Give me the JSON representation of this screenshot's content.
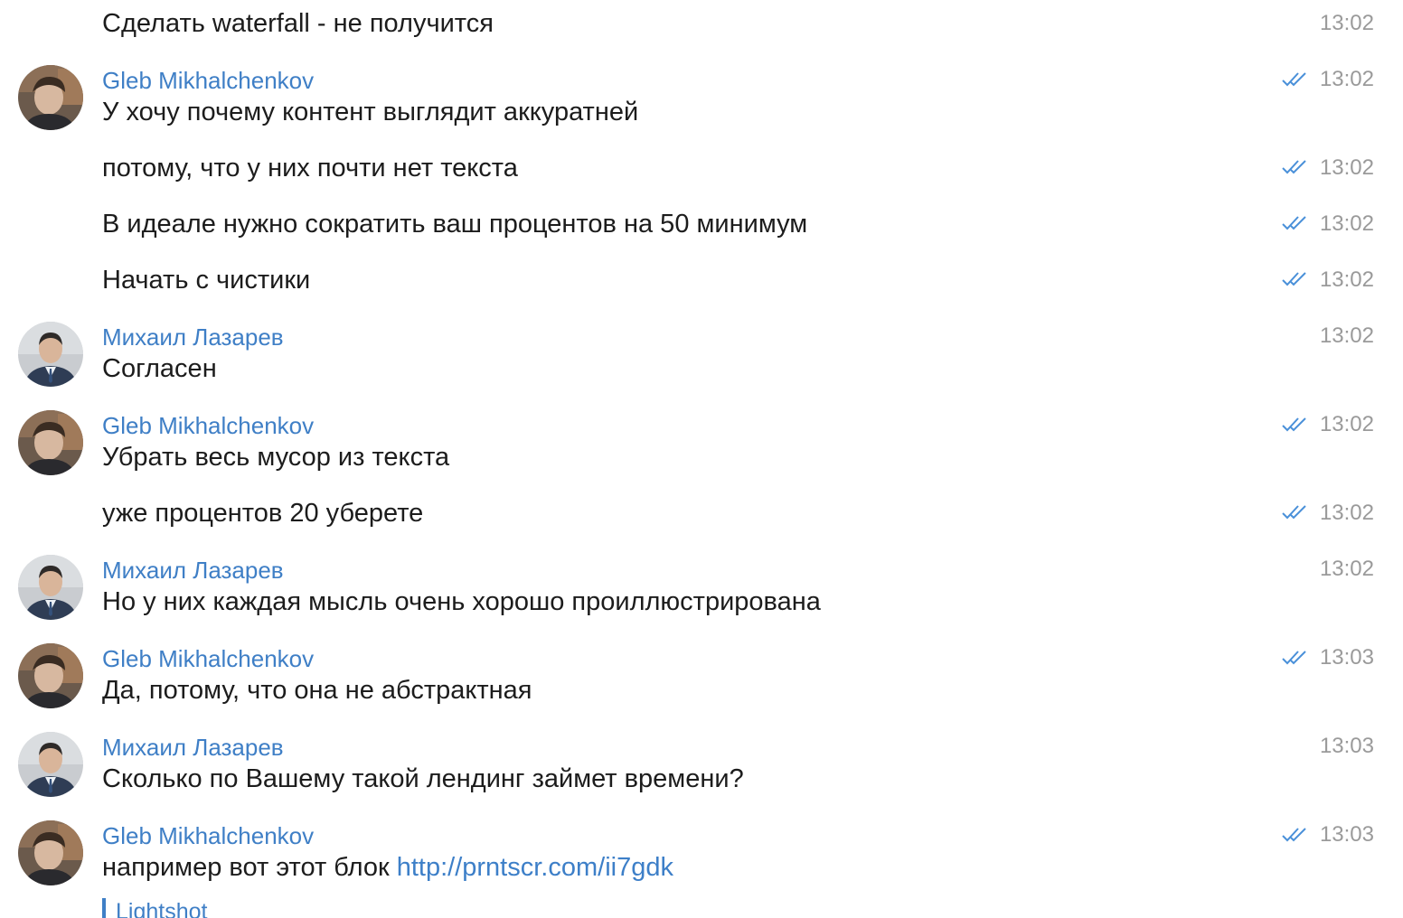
{
  "messages": [
    {
      "text": "Сделать waterfall - не получится",
      "time": "13:02"
    },
    {
      "sender": "Gleb Mikhalchenkov",
      "text": "У хочу почему контент выглядит аккуратней",
      "time": "13:02"
    },
    {
      "text": "потому, что у них почти нет текста",
      "time": "13:02"
    },
    {
      "text": "В идеале нужно сократить ваш процентов на 50 минимум",
      "time": "13:02"
    },
    {
      "text": "Начать с чистики",
      "time": "13:02"
    },
    {
      "sender": "Михаил Лазарев",
      "text": "Согласен",
      "time": "13:02"
    },
    {
      "sender": "Gleb Mikhalchenkov",
      "text": "Убрать весь мусор из текста",
      "time": "13:02"
    },
    {
      "text": "уже процентов 20 уберете",
      "time": "13:02"
    },
    {
      "sender": "Михаил Лазарев",
      "text": "Но у них каждая мысль очень хорошо проиллюстрирована",
      "time": "13:02"
    },
    {
      "sender": "Gleb Mikhalchenkov",
      "text": "Да, потому, что она не абстрактная",
      "time": "13:03"
    },
    {
      "sender": "Михаил Лазарев",
      "text": "Сколько по Вашему такой лендинг займет времени?",
      "time": "13:03"
    },
    {
      "sender": "Gleb Mikhalchenkov",
      "text": "например вот этот блок ",
      "link": "http://prntscr.com/ii7gdk",
      "time": "13:03"
    }
  ],
  "link_preview": {
    "title": "Lightshot"
  },
  "colors": {
    "sender_name": "#3f7fc6",
    "link": "#3d7fc8",
    "read_check": "#4a90d9",
    "timestamp": "#9a9a9a"
  },
  "icons": {
    "read_status": "double-check-icon",
    "gleb_avatar": "avatar-gleb",
    "mikhail_avatar": "avatar-mikhail"
  }
}
